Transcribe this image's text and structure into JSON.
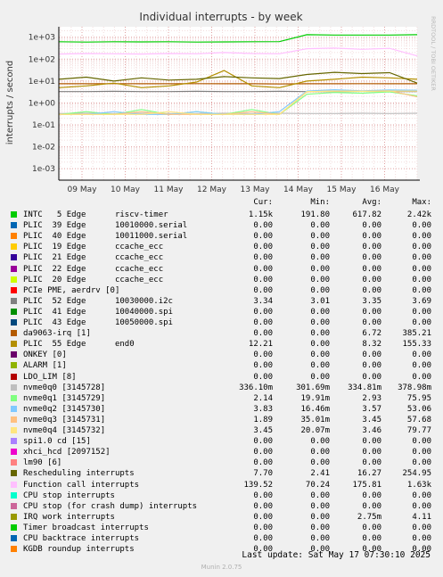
{
  "chart_data": {
    "type": "line",
    "title": "Individual interrupts - by week",
    "ylabel": "interrupts / second",
    "yscale": "log",
    "ylim": [
      0.0003,
      3000
    ],
    "yticks": [
      "1e+03",
      "1e+02",
      "1e+01",
      "1e+00",
      "1e-01",
      "1e-02",
      "1e-03"
    ],
    "xticks": [
      "09 May",
      "10 May",
      "11 May",
      "12 May",
      "13 May",
      "14 May",
      "15 May",
      "16 May"
    ],
    "side_label": "RRDTOOL / TOBI OETIKER",
    "grid": true,
    "series": [
      {
        "name": "INTC   5 Edge      riscv-timer",
        "color": "#00cc00",
        "cur": "1.15k",
        "min": "191.80",
        "avg": "617.82",
        "max": "2.42k",
        "values": [
          620,
          600,
          620,
          610,
          620,
          600,
          610,
          620,
          630,
          1300,
          1250,
          1250,
          1250,
          1300
        ]
      },
      {
        "name": "PLIC  39 Edge      10010000.serial",
        "color": "#0066b3",
        "cur": "0.00",
        "min": "0.00",
        "avg": "0.00",
        "max": "0.00",
        "values": []
      },
      {
        "name": "PLIC  40 Edge      10011000.serial",
        "color": "#ff8000",
        "cur": "0.00",
        "min": "0.00",
        "avg": "0.00",
        "max": "0.00",
        "values": []
      },
      {
        "name": "PLIC  19 Edge      ccache_ecc",
        "color": "#ffcc00",
        "cur": "0.00",
        "min": "0.00",
        "avg": "0.00",
        "max": "0.00",
        "values": []
      },
      {
        "name": "PLIC  21 Edge      ccache_ecc",
        "color": "#330099",
        "cur": "0.00",
        "min": "0.00",
        "avg": "0.00",
        "max": "0.00",
        "values": []
      },
      {
        "name": "PLIC  22 Edge      ccache_ecc",
        "color": "#990099",
        "cur": "0.00",
        "min": "0.00",
        "avg": "0.00",
        "max": "0.00",
        "values": []
      },
      {
        "name": "PLIC  20 Edge      ccache_ecc",
        "color": "#ccff00",
        "cur": "0.00",
        "min": "0.00",
        "avg": "0.00",
        "max": "0.00",
        "values": []
      },
      {
        "name": "PCIe PME, aerdrv [0]",
        "color": "#ff0000",
        "cur": "0.00",
        "min": "0.00",
        "avg": "0.00",
        "max": "0.00",
        "values": []
      },
      {
        "name": "PLIC  52 Edge      10030000.i2c",
        "color": "#808080",
        "cur": "3.34",
        "min": "3.01",
        "avg": "3.35",
        "max": "3.69",
        "values": [
          3.3,
          3.3,
          3.4,
          3.3,
          3.3,
          3.4,
          3.3,
          3.3,
          3.4,
          3.3,
          3.3,
          3.4,
          3.3,
          3.3
        ]
      },
      {
        "name": "PLIC  41 Edge      10040000.spi",
        "color": "#008f00",
        "cur": "0.00",
        "min": "0.00",
        "avg": "0.00",
        "max": "0.00",
        "values": []
      },
      {
        "name": "PLIC  43 Edge      10050000.spi",
        "color": "#00487d",
        "cur": "0.00",
        "min": "0.00",
        "avg": "0.00",
        "max": "0.00",
        "values": []
      },
      {
        "name": "da9063-irq [1]",
        "color": "#b35a00",
        "cur": "0.00",
        "min": "0.00",
        "avg": "6.72",
        "max": "385.21",
        "values": [
          7.5,
          7.5,
          7.6,
          7.5,
          7.5,
          7.6,
          7.5,
          7.5,
          7.4,
          7.5,
          7.5,
          7.6,
          7.5,
          7.5
        ]
      },
      {
        "name": "PLIC  55 Edge      end0",
        "color": "#b38f00",
        "cur": "12.21",
        "min": "0.00",
        "avg": "8.32",
        "max": "155.33",
        "values": [
          5,
          6,
          8,
          5,
          6,
          9,
          30,
          6,
          5,
          10,
          12,
          15,
          14,
          12
        ]
      },
      {
        "name": "ONKEY [0]",
        "color": "#6b006b",
        "cur": "0.00",
        "min": "0.00",
        "avg": "0.00",
        "max": "0.00",
        "values": []
      },
      {
        "name": "ALARM [1]",
        "color": "#8fb300",
        "cur": "0.00",
        "min": "0.00",
        "avg": "0.00",
        "max": "0.00",
        "values": []
      },
      {
        "name": "LDO_LIM [8]",
        "color": "#b30000",
        "cur": "0.00",
        "min": "0.00",
        "avg": "0.00",
        "max": "0.00",
        "values": []
      },
      {
        "name": "nvme0q0 [3145728]",
        "color": "#bebebe",
        "cur": "336.10m",
        "min": "301.69m",
        "avg": "334.81m",
        "max": "378.98m",
        "values": [
          0.33,
          0.34,
          0.33,
          0.34,
          0.33,
          0.33,
          0.34,
          0.33,
          0.34,
          0.33,
          0.33,
          0.34,
          0.33,
          0.34
        ]
      },
      {
        "name": "nvme0q1 [3145729]",
        "color": "#80ff80",
        "cur": "2.14",
        "min": "19.91m",
        "avg": "2.93",
        "max": "75.95",
        "values": [
          0.3,
          0.4,
          0.3,
          0.5,
          0.3,
          0.4,
          0.3,
          0.5,
          0.3,
          2.5,
          3,
          2.8,
          3.2,
          2.1
        ]
      },
      {
        "name": "nvme0q2 [3145730]",
        "color": "#80c9ff",
        "cur": "3.83",
        "min": "16.46m",
        "avg": "3.57",
        "max": "53.06",
        "values": [
          0.3,
          0.3,
          0.4,
          0.3,
          0.3,
          0.4,
          0.3,
          0.3,
          0.4,
          3.5,
          4,
          3.6,
          3.9,
          3.8
        ]
      },
      {
        "name": "nvme0q3 [3145731]",
        "color": "#ffc080",
        "cur": "1.89",
        "min": "35.01m",
        "avg": "3.45",
        "max": "57.68",
        "values": [
          0.3,
          0.3,
          0.3,
          0.4,
          0.3,
          0.3,
          0.3,
          0.4,
          0.3,
          3.2,
          3.5,
          3.4,
          3.6,
          1.9
        ]
      },
      {
        "name": "nvme0q4 [3145732]",
        "color": "#ffe680",
        "cur": "3.45",
        "min": "20.07m",
        "avg": "3.46",
        "max": "79.77",
        "values": [
          0.3,
          0.3,
          0.3,
          0.3,
          0.4,
          0.3,
          0.3,
          0.3,
          0.3,
          3.3,
          3.5,
          3.4,
          3.5,
          3.45
        ]
      },
      {
        "name": "spi1.0 cd [15]",
        "color": "#aa80ff",
        "cur": "0.00",
        "min": "0.00",
        "avg": "0.00",
        "max": "0.00",
        "values": []
      },
      {
        "name": "xhci_hcd [2097152]",
        "color": "#ee00cc",
        "cur": "0.00",
        "min": "0.00",
        "avg": "0.00",
        "max": "0.00",
        "values": []
      },
      {
        "name": "lm90 [6]",
        "color": "#ff8080",
        "cur": "0.00",
        "min": "0.00",
        "avg": "0.00",
        "max": "0.00",
        "values": []
      },
      {
        "name": "Rescheduling interrupts",
        "color": "#666600",
        "cur": "7.70",
        "min": "2.41",
        "avg": "16.27",
        "max": "254.95",
        "values": [
          12,
          15,
          10,
          14,
          11,
          12,
          16,
          14,
          13,
          20,
          25,
          22,
          24,
          8
        ]
      },
      {
        "name": "Function call interrupts",
        "color": "#ffbfff",
        "cur": "139.52",
        "min": "70.24",
        "avg": "175.81",
        "max": "1.63k",
        "values": [
          170,
          180,
          175,
          170,
          180,
          175,
          200,
          180,
          175,
          300,
          320,
          280,
          310,
          140
        ]
      },
      {
        "name": "CPU stop interrupts",
        "color": "#00ffcc",
        "cur": "0.00",
        "min": "0.00",
        "avg": "0.00",
        "max": "0.00",
        "values": []
      },
      {
        "name": "CPU stop (for crash dump) interrupts",
        "color": "#cc6699",
        "cur": "0.00",
        "min": "0.00",
        "avg": "0.00",
        "max": "0.00",
        "values": []
      },
      {
        "name": "IRQ work interrupts",
        "color": "#999900",
        "cur": "0.00",
        "min": "0.00",
        "avg": "2.75m",
        "max": "4.11",
        "values": []
      },
      {
        "name": "Timer broadcast interrupts",
        "color": "#00cc00",
        "cur": "0.00",
        "min": "0.00",
        "avg": "0.00",
        "max": "0.00",
        "values": []
      },
      {
        "name": "CPU backtrace interrupts",
        "color": "#0066b3",
        "cur": "0.00",
        "min": "0.00",
        "avg": "0.00",
        "max": "0.00",
        "values": []
      },
      {
        "name": "KGDB roundup interrupts",
        "color": "#ff8000",
        "cur": "0.00",
        "min": "0.00",
        "avg": "0.00",
        "max": "0.00",
        "values": []
      }
    ]
  },
  "legend_header": {
    "cur": "Cur:",
    "min": "Min:",
    "avg": "Avg:",
    "max": "Max:"
  },
  "footer": "Last update: Sat May 17 07:30:10 2025",
  "generator": "Munin 2.0.75"
}
